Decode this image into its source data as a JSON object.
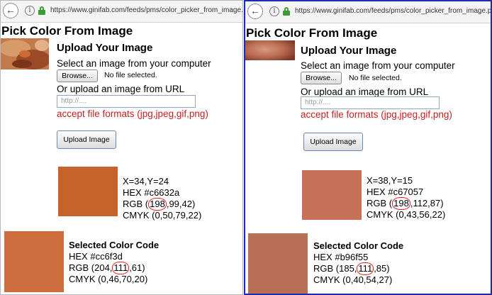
{
  "panels": [
    {
      "url": "https://www.ginifab.com/feeds/pms/color_picker_from_image.php",
      "page_title": "Pick Color From Image",
      "upload_heading": "Upload Your Image",
      "select_text": "Select an image from your computer",
      "browse_label": "Browse...",
      "no_file_text": "No file selected.",
      "or_url_text": "Or upload an image from URL",
      "url_placeholder": "http://....",
      "formats_text": "accept file formats (jpg,jpeg,gif,png)",
      "upload_button": "Upload Image",
      "picked": {
        "swatch_color": "#c6632a",
        "coords": "X=34,Y=24",
        "hex": "HEX #c6632a",
        "rgb_prefix": "RGB (",
        "rgb_hl": "198",
        "rgb_suffix": ",99,42)",
        "cmyk": "CMYK (0,50,79,22)"
      },
      "selected": {
        "swatch_color": "#cc6f3d",
        "heading": "Selected Color Code",
        "hex": "HEX #cc6f3d",
        "rgb_prefix": "RGB (204,",
        "rgb_hl": "111",
        "rgb_suffix": ",61)",
        "cmyk": "CMYK (0,46,70,20)"
      }
    },
    {
      "url": "https://www.ginifab.com/feeds/pms/color_picker_from_image.php",
      "page_title": "Pick Color From Image",
      "upload_heading": "Upload Your Image",
      "select_text": "Select an image from your computer",
      "browse_label": "Browse...",
      "no_file_text": "No file selected.",
      "or_url_text": "Or upload an image from URL",
      "url_placeholder": "http://....",
      "formats_text": "accept file formats (jpg,jpeg,gif,png)",
      "upload_button": "Upload Image",
      "picked": {
        "swatch_color": "#c67057",
        "coords": "X=38,Y=15",
        "hex": "HEX #c67057",
        "rgb_prefix": "RGB (",
        "rgb_hl": "198",
        "rgb_suffix": ",112,87)",
        "cmyk": "CMYK (0,43,56,22)"
      },
      "selected": {
        "swatch_color": "#b96f55",
        "heading": "Selected Color Code",
        "hex": "HEX #b96f55",
        "rgb_prefix": "RGB (185,",
        "rgb_hl": "111",
        "rgb_suffix": ",85)",
        "cmyk": "CMYK (0,40,54,27)"
      }
    }
  ],
  "colors": {
    "highlight_circle": "#e02020",
    "formats_text": "#c41f1f",
    "divider": "#1e2bb0",
    "lock": "#3d9b35"
  },
  "icons": [
    "back-arrow-icon",
    "info-icon",
    "lock-icon"
  ]
}
